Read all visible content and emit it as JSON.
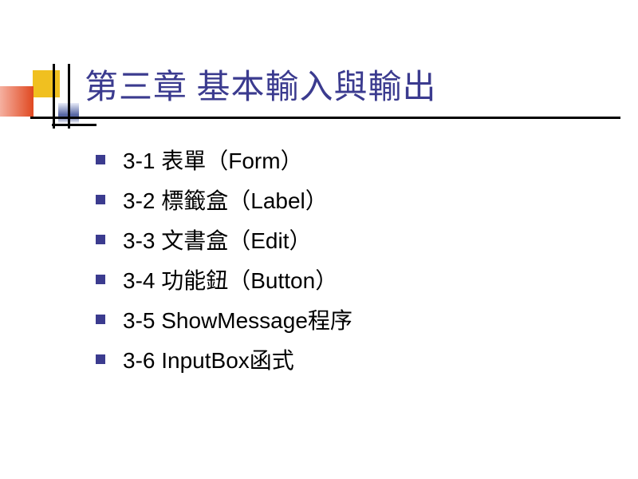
{
  "title": "第三章  基本輸入與輸出",
  "items": [
    "3-1  表單（Form）",
    "3-2  標籤盒（Label）",
    "3-3  文書盒（Edit）",
    "3-4  功能鈕（Button）",
    "3-5  ShowMessage程序",
    "3-6  InputBox函式"
  ]
}
